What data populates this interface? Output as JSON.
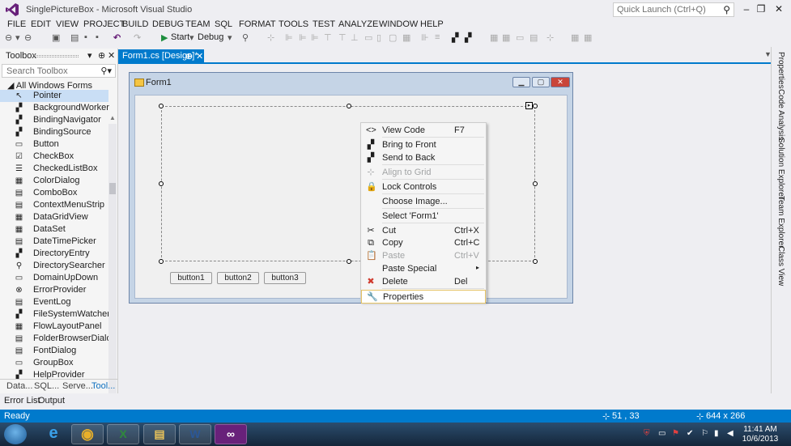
{
  "window": {
    "title": "SinglePictureBox - Microsoft Visual Studio",
    "quick_launch_placeholder": "Quick Launch (Ctrl+Q)",
    "minimize": "–",
    "restore": "❐",
    "close": "✕"
  },
  "menu": [
    "FILE",
    "EDIT",
    "VIEW",
    "PROJECT",
    "BUILD",
    "DEBUG",
    "TEAM",
    "SQL",
    "FORMAT",
    "TOOLS",
    "TEST",
    "ANALYZE",
    "WINDOW",
    "HELP"
  ],
  "toolbar": {
    "start_label": "Start",
    "config_value": "Debug"
  },
  "toolbox": {
    "title": "Toolbox",
    "search_placeholder": "Search Toolbox",
    "group": "All Windows Forms",
    "items": [
      {
        "label": "Pointer",
        "icon": "pointer-icon",
        "glyph": "↖"
      },
      {
        "label": "BackgroundWorker",
        "icon": "backgroundworker-icon",
        "glyph": "▞"
      },
      {
        "label": "BindingNavigator",
        "icon": "bindingnavigator-icon",
        "glyph": "▞"
      },
      {
        "label": "BindingSource",
        "icon": "bindingsource-icon",
        "glyph": "▞"
      },
      {
        "label": "Button",
        "icon": "button-icon",
        "glyph": "▭"
      },
      {
        "label": "CheckBox",
        "icon": "checkbox-icon",
        "glyph": "☑"
      },
      {
        "label": "CheckedListBox",
        "icon": "checkedlistbox-icon",
        "glyph": "☰"
      },
      {
        "label": "ColorDialog",
        "icon": "colordialog-icon",
        "glyph": "▦"
      },
      {
        "label": "ComboBox",
        "icon": "combobox-icon",
        "glyph": "▤"
      },
      {
        "label": "ContextMenuStrip",
        "icon": "contextmenustrip-icon",
        "glyph": "▤"
      },
      {
        "label": "DataGridView",
        "icon": "datagridview-icon",
        "glyph": "▦"
      },
      {
        "label": "DataSet",
        "icon": "dataset-icon",
        "glyph": "▦"
      },
      {
        "label": "DateTimePicker",
        "icon": "datetimepicker-icon",
        "glyph": "▤"
      },
      {
        "label": "DirectoryEntry",
        "icon": "directoryentry-icon",
        "glyph": "▞"
      },
      {
        "label": "DirectorySearcher",
        "icon": "directorysearcher-icon",
        "glyph": "⚲"
      },
      {
        "label": "DomainUpDown",
        "icon": "domainupdown-icon",
        "glyph": "▭"
      },
      {
        "label": "ErrorProvider",
        "icon": "errorprovider-icon",
        "glyph": "⊗"
      },
      {
        "label": "EventLog",
        "icon": "eventlog-icon",
        "glyph": "▤"
      },
      {
        "label": "FileSystemWatcher",
        "icon": "filesystemwatcher-icon",
        "glyph": "▞"
      },
      {
        "label": "FlowLayoutPanel",
        "icon": "flowlayoutpanel-icon",
        "glyph": "▦"
      },
      {
        "label": "FolderBrowserDialog",
        "icon": "folderbrowserdialog-icon",
        "glyph": "▤"
      },
      {
        "label": "FontDialog",
        "icon": "fontdialog-icon",
        "glyph": "▤"
      },
      {
        "label": "GroupBox",
        "icon": "groupbox-icon",
        "glyph": "▭"
      },
      {
        "label": "HelpProvider",
        "icon": "helpprovider-icon",
        "glyph": "▞"
      }
    ],
    "tabs": [
      "Data...",
      "SQL...",
      "Serve...",
      "Tool..."
    ]
  },
  "document": {
    "tab_label": "Form1.cs [Design]*",
    "pin": "⊕",
    "close": "✕"
  },
  "form": {
    "title": "Form1",
    "buttons": [
      "button1",
      "button2",
      "button3"
    ]
  },
  "context_menu": {
    "items": [
      {
        "label": "View Code",
        "shortcut": "F7",
        "icon": "view-code-icon",
        "glyph": "<>"
      },
      {
        "label": "Bring to Front",
        "shortcut": "",
        "icon": "bring-to-front-icon",
        "glyph": "▞"
      },
      {
        "label": "Send to Back",
        "shortcut": "",
        "icon": "send-to-back-icon",
        "glyph": "▞"
      },
      {
        "label": "Align to Grid",
        "shortcut": "",
        "icon": "align-to-grid-icon",
        "glyph": "⊹"
      },
      {
        "label": "Lock Controls",
        "shortcut": "",
        "icon": "lock-icon",
        "glyph": "🔒"
      },
      {
        "label": "Choose Image...",
        "shortcut": "",
        "icon": "",
        "glyph": ""
      },
      {
        "label": "Select 'Form1'",
        "shortcut": "",
        "icon": "",
        "glyph": ""
      },
      {
        "label": "Cut",
        "shortcut": "Ctrl+X",
        "icon": "cut-icon",
        "glyph": "✂"
      },
      {
        "label": "Copy",
        "shortcut": "Ctrl+C",
        "icon": "copy-icon",
        "glyph": "⧉"
      },
      {
        "label": "Paste",
        "shortcut": "Ctrl+V",
        "icon": "paste-icon",
        "glyph": "📋"
      },
      {
        "label": "Paste Special",
        "shortcut": "",
        "icon": "",
        "glyph": ""
      },
      {
        "label": "Delete",
        "shortcut": "Del",
        "icon": "delete-icon",
        "glyph": "✖"
      },
      {
        "label": "Properties",
        "shortcut": "",
        "icon": "properties-icon",
        "glyph": "🔧"
      }
    ]
  },
  "right_tabs": [
    "Properties",
    "Code Analysis",
    "Solution Explorer",
    "Team Explorer",
    "Class View"
  ],
  "bottom_tabs": [
    "Error List",
    "Output"
  ],
  "status": {
    "text": "Ready",
    "position": "51 , 33",
    "size": "644 x 266"
  },
  "taskbar": {
    "time": "11:41 AM",
    "date": "10/6/2013"
  },
  "colors": {
    "accent": "#007acc",
    "delete_red": "#d03b2e"
  }
}
